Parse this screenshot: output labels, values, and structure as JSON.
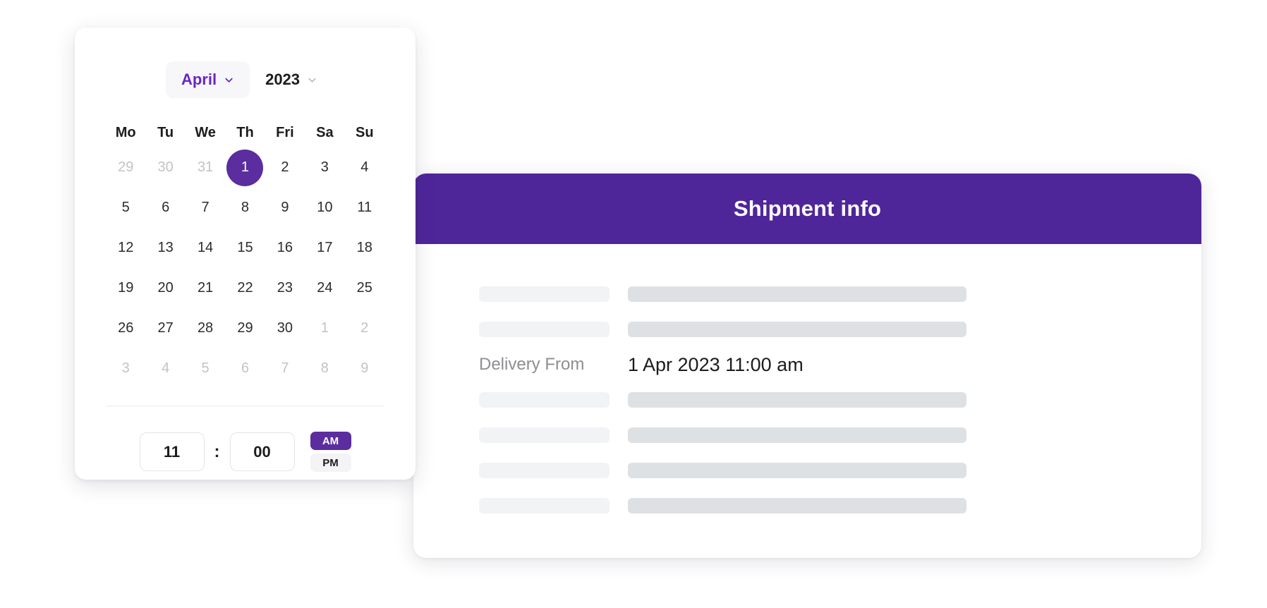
{
  "theme": {
    "accent_purple": "#5B2D9E",
    "header_purple": "#4F2699",
    "month_text_purple": "#6926C4",
    "muted_gray": "#C3C3C7",
    "skeleton_light": "#F1F3F5",
    "skeleton_dark": "#DEE1E3"
  },
  "calendar": {
    "month": "April",
    "year": "2023",
    "month_chevron_icon": "chevron-down-icon",
    "year_chevron_icon": "chevron-down-icon",
    "weekdays": [
      "Mo",
      "Tu",
      "We",
      "Th",
      "Fri",
      "Sa",
      "Su"
    ],
    "weeks": [
      [
        {
          "label": "29",
          "muted": true,
          "selected": false
        },
        {
          "label": "30",
          "muted": true,
          "selected": false
        },
        {
          "label": "31",
          "muted": true,
          "selected": false
        },
        {
          "label": "1",
          "muted": false,
          "selected": true
        },
        {
          "label": "2",
          "muted": false,
          "selected": false
        },
        {
          "label": "3",
          "muted": false,
          "selected": false
        },
        {
          "label": "4",
          "muted": false,
          "selected": false
        }
      ],
      [
        {
          "label": "5",
          "muted": false,
          "selected": false
        },
        {
          "label": "6",
          "muted": false,
          "selected": false
        },
        {
          "label": "7",
          "muted": false,
          "selected": false
        },
        {
          "label": "8",
          "muted": false,
          "selected": false
        },
        {
          "label": "9",
          "muted": false,
          "selected": false
        },
        {
          "label": "10",
          "muted": false,
          "selected": false
        },
        {
          "label": "11",
          "muted": false,
          "selected": false
        }
      ],
      [
        {
          "label": "12",
          "muted": false,
          "selected": false
        },
        {
          "label": "13",
          "muted": false,
          "selected": false
        },
        {
          "label": "14",
          "muted": false,
          "selected": false
        },
        {
          "label": "15",
          "muted": false,
          "selected": false
        },
        {
          "label": "16",
          "muted": false,
          "selected": false
        },
        {
          "label": "17",
          "muted": false,
          "selected": false
        },
        {
          "label": "18",
          "muted": false,
          "selected": false
        }
      ],
      [
        {
          "label": "19",
          "muted": false,
          "selected": false
        },
        {
          "label": "20",
          "muted": false,
          "selected": false
        },
        {
          "label": "21",
          "muted": false,
          "selected": false
        },
        {
          "label": "22",
          "muted": false,
          "selected": false
        },
        {
          "label": "23",
          "muted": false,
          "selected": false
        },
        {
          "label": "24",
          "muted": false,
          "selected": false
        },
        {
          "label": "25",
          "muted": false,
          "selected": false
        }
      ],
      [
        {
          "label": "26",
          "muted": false,
          "selected": false
        },
        {
          "label": "27",
          "muted": false,
          "selected": false
        },
        {
          "label": "28",
          "muted": false,
          "selected": false
        },
        {
          "label": "29",
          "muted": false,
          "selected": false
        },
        {
          "label": "30",
          "muted": false,
          "selected": false
        },
        {
          "label": "1",
          "muted": true,
          "selected": false
        },
        {
          "label": "2",
          "muted": true,
          "selected": false
        }
      ],
      [
        {
          "label": "3",
          "muted": true,
          "selected": false
        },
        {
          "label": "4",
          "muted": true,
          "selected": false
        },
        {
          "label": "5",
          "muted": true,
          "selected": false
        },
        {
          "label": "6",
          "muted": true,
          "selected": false
        },
        {
          "label": "7",
          "muted": true,
          "selected": false
        },
        {
          "label": "8",
          "muted": true,
          "selected": false
        },
        {
          "label": "9",
          "muted": true,
          "selected": false
        }
      ]
    ],
    "time": {
      "hour": "11",
      "separator": ":",
      "minute": "00",
      "am_label": "AM",
      "pm_label": "PM",
      "selected_meridiem": "AM"
    }
  },
  "shipment": {
    "title": "Shipment info",
    "rows": [
      {
        "type": "skeleton"
      },
      {
        "type": "skeleton"
      },
      {
        "type": "value",
        "label": "Delivery From",
        "value": "1 Apr 2023 11:00 am"
      },
      {
        "type": "skeleton"
      },
      {
        "type": "skeleton"
      },
      {
        "type": "skeleton"
      },
      {
        "type": "skeleton"
      }
    ]
  }
}
